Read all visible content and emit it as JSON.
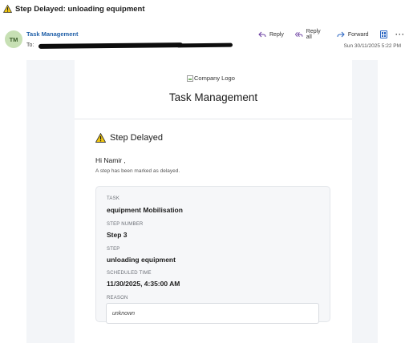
{
  "subject": "Step Delayed: unloading equipment",
  "header": {
    "avatar_initials": "TM",
    "sender": "Task Management",
    "to_label": "To:",
    "actions": {
      "reply": "Reply",
      "reply_all": "Reply all",
      "forward": "Forward",
      "more": "···"
    },
    "date": "Sun 30/11/2025 5:22 PM"
  },
  "email": {
    "logo_alt": "Company Logo",
    "title": "Task Management",
    "alert_title": "Step Delayed",
    "greeting": "Hi Namir ,",
    "note": "A step has been marked as delayed.",
    "details": {
      "task_label": "TASK",
      "task_value": "equipment Mobilisation",
      "step_number_label": "STEP NUMBER",
      "step_number_value": "Step 3",
      "step_label": "STEP",
      "step_value": "unloading equipment",
      "scheduled_label": "SCHEDULED TIME",
      "scheduled_value": "11/30/2025, 4:35:00 AM",
      "reason_label": "REASON",
      "reason_value": "unknown"
    }
  },
  "colors": {
    "warning": "#f2c811",
    "accent": "#1f5fa8",
    "avatar_bg": "#c7e0b4"
  },
  "icons": {
    "warning": "warning-triangle-icon",
    "reply": "reply-arrow-icon",
    "reply_all": "reply-all-arrow-icon",
    "forward": "forward-arrow-icon",
    "immersive": "immersive-reader-icon",
    "more": "more-options-icon"
  }
}
